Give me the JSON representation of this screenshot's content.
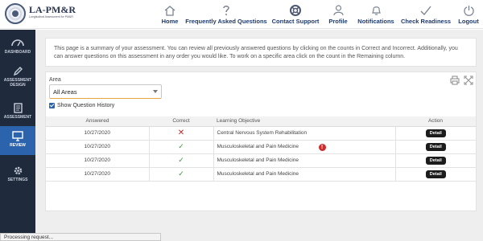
{
  "logo": {
    "name": "LA-PM&R",
    "subtitle": "Longitudinal Assessment for PM&R"
  },
  "nav": [
    {
      "label": "Home",
      "icon": "home-icon"
    },
    {
      "label": "Frequently Asked Questions",
      "icon": "question-icon"
    },
    {
      "label": "Contact Support",
      "icon": "lifebuoy-icon"
    },
    {
      "label": "Profile",
      "icon": "user-icon"
    },
    {
      "label": "Notifications",
      "icon": "bell-icon"
    },
    {
      "label": "Check Readiness",
      "icon": "checkmark-icon"
    },
    {
      "label": "Logout",
      "icon": "power-icon"
    }
  ],
  "sidebar": [
    {
      "label": "DASHBOARD",
      "icon": "dashboard-icon"
    },
    {
      "label": "ASSESSMENT DESIGN",
      "icon": "pencil-icon"
    },
    {
      "label": "ASSESSMENT",
      "icon": "document-icon"
    },
    {
      "label": "REVIEW",
      "icon": "monitor-icon",
      "active": true
    },
    {
      "label": "SETTINGS",
      "icon": "gear-icon"
    }
  ],
  "intro": {
    "text": "This page is a summary of your assessment. You can review all previously answered questions by clicking on the counts in Correct and Incorrect. Additionally, you can answer questions on this assessment in any order you would like. To work on a specific area click on the count in the Remaining column."
  },
  "filter": {
    "area_label": "Area",
    "area_value": "All Areas",
    "history_label": "Show Question History",
    "history_checked": true
  },
  "table": {
    "headers": [
      "Answered",
      "Correct",
      "Learning Objective",
      "Action"
    ],
    "rows": [
      {
        "answered": "10/27/2020",
        "correct": false,
        "objective": "Central Nervous System Rehabilitation",
        "action": "Detail",
        "flag": false
      },
      {
        "answered": "10/27/2020",
        "correct": true,
        "objective": "Musculoskeletal and Pain Medicine",
        "action": "Detail",
        "flag": true
      },
      {
        "answered": "10/27/2020",
        "correct": true,
        "objective": "Musculoskeletal and Pain Medicine",
        "action": "Detail",
        "flag": false
      },
      {
        "answered": "10/27/2020",
        "correct": true,
        "objective": "Musculoskeletal and Pain Medicine",
        "action": "Detail",
        "flag": false
      }
    ]
  },
  "status": {
    "text": "Processing request..."
  },
  "colors": {
    "nav_text": "#1f3a6e",
    "sidebar_bg": "#1f2a3c",
    "sidebar_active": "#2b63ad",
    "incorrect": "#c0262a",
    "correct": "#3a9a3a"
  }
}
